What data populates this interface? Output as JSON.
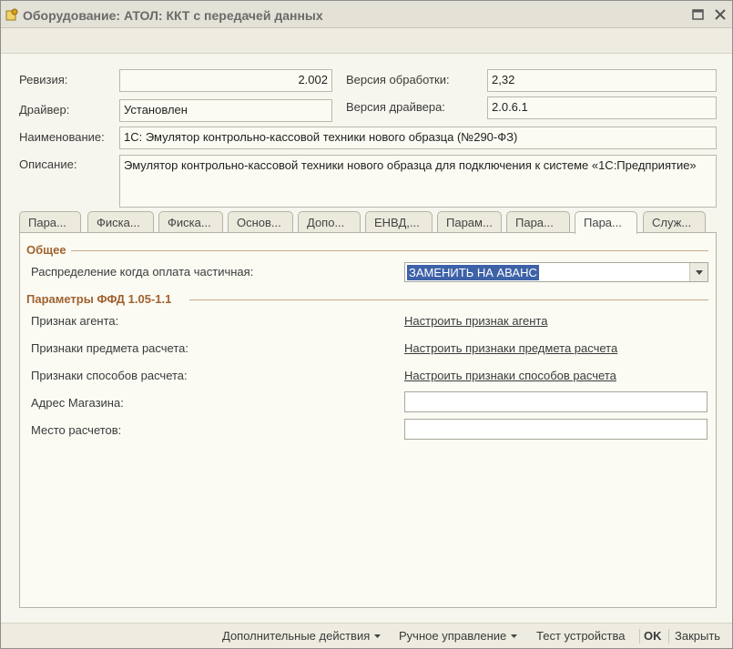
{
  "window": {
    "title": "Оборудование: АТОЛ: ККТ с передачей данных"
  },
  "header": {
    "revision_label": "Ревизия:",
    "revision_value": "2.002",
    "processing_version_label": "Версия обработки:",
    "processing_version_value": "2,32",
    "driver_label": "Драйвер:",
    "driver_value": "Установлен",
    "driver_version_label": "Версия драйвера:",
    "driver_version_value": "2.0.6.1",
    "name_label": "Наименование:",
    "name_value": "1С: Эмулятор контрольно-кассовой техники нового образца (№290-ФЗ)",
    "description_label": "Описание:",
    "description_value": "Эмулятор контрольно-кассовой техники нового образца для подключения к системе «1С:Предприятие»"
  },
  "tabs": [
    {
      "label": "Пара..."
    },
    {
      "label": "Фиска..."
    },
    {
      "label": "Фиска..."
    },
    {
      "label": "Основ..."
    },
    {
      "label": "Допо..."
    },
    {
      "label": "ЕНВД,..."
    },
    {
      "label": "Парам..."
    },
    {
      "label": "Пара..."
    },
    {
      "label": "Пара..."
    },
    {
      "label": "Служ..."
    }
  ],
  "panel": {
    "general_title": "Общее",
    "distribution_label": "Распределение когда оплата частичная:",
    "distribution_value": "ЗАМЕНИТЬ НА АВАНС",
    "ffd_title": "Параметры ФФД 1.05-1.1",
    "agent_label": "Признак агента:",
    "agent_link": "Настроить признак агента",
    "subject_label": "Признаки предмета расчета:",
    "subject_link": "Настроить признаки предмета расчета",
    "method_label": "Признаки способов расчета:",
    "method_link": "Настроить признаки способов расчета",
    "shop_address_label": "Адрес Магазина:",
    "shop_address_value": "",
    "place_label": "Место расчетов:",
    "place_value": ""
  },
  "bottom": {
    "more_actions": "Дополнительные действия",
    "manual_control": "Ручное управление",
    "test_device": "Тест устройства",
    "ok": "OK",
    "close": "Закрыть"
  },
  "colors": {
    "section_title": "#a0622e",
    "selection": "#3e62a8"
  }
}
